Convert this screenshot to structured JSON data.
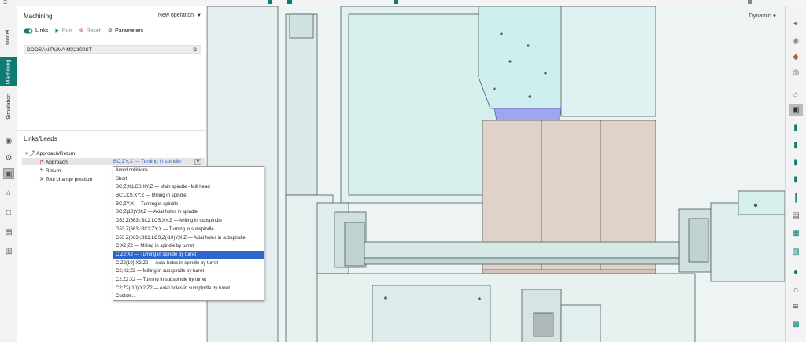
{
  "sidebar_tabs": {
    "model": "Model",
    "machining": "Machining",
    "simulation": "Simulation"
  },
  "panel": {
    "title": "Machining",
    "new_operation": "New operation",
    "toolbar": {
      "links": "Links",
      "run": "Run",
      "reset": "Reset",
      "parameters": "Parameters"
    },
    "machine": "DOOSAN PUMA MX2100ST"
  },
  "links": {
    "title": "Links/Leads",
    "approach_return": "Approach/Return",
    "approach": "Approach",
    "return": "Return",
    "tool_change": "Tool change position",
    "approach_value": "BC;ZY;X — Turning in spindle"
  },
  "dropdown": {
    "items": [
      "Avoid collisions",
      "Short",
      "BC;Z;X;LCS;XY;Z — Main spindle - Mill head",
      "BC;LCS;XY;Z — Milling in spindle",
      "BC;ZY;X — Turning in spindle",
      "BC;Z(10)Y;X;Z — Axial holes in spindle",
      "G53 Z(663);BC2;LCS;XY;Z — Milling in subspindle",
      "G53 Z(663);BC2;ZY;X — Turning in subspindle",
      "G53 Z(663);BC2;LCS;Z(-10)Y;X;Z — Axial holes in subspindle",
      "C;X2;Z2 — Milling in spindle by turret",
      "C;Z2;X2 — Turning in spindle by turret",
      "C;Z2(10);X2;Z2 — Axial holes in spindle by turret",
      "C2;X2;Z2 — Milling in subspindle by turret",
      "C2;Z2;X2 — Turning in subspindle by turret",
      "C2;Z2(-10);X2;Z2 — Axial holes in subspindle by turret",
      "Custom..."
    ],
    "selected_index": 10
  },
  "viewport": {
    "view_mode": "Dynamic"
  },
  "colors": {
    "accent": "#0e7c74",
    "selection": "#2f66c9",
    "machine_fill": "#d6efed",
    "column_fill": "#e0d2c9"
  }
}
